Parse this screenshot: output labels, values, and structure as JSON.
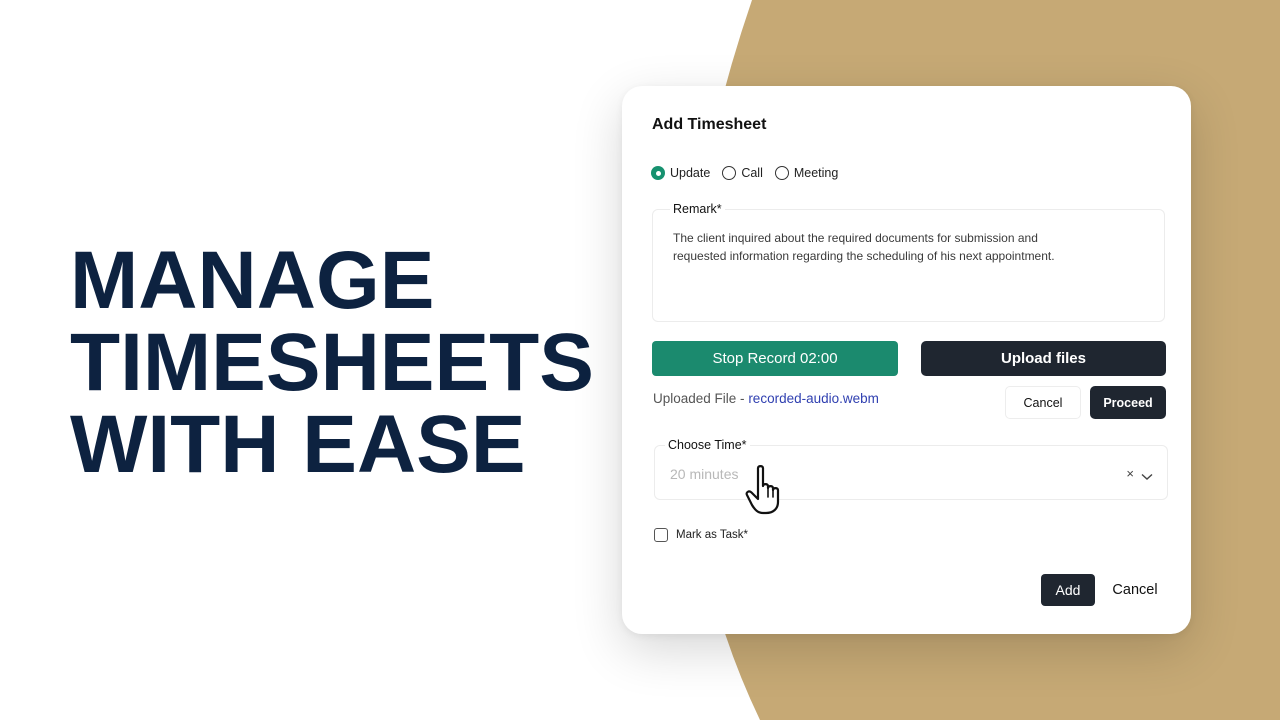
{
  "headline": {
    "line1": "MANAGE",
    "line2": "TIMESHEETS",
    "line3": "WITH EASE"
  },
  "colors": {
    "accent_tan": "#c6a975",
    "headline_navy": "#0d2240",
    "record_green": "#1b8a6e",
    "dark_button": "#1f2630",
    "link_blue": "#2f3fb0"
  },
  "dialog": {
    "title": "Add Timesheet",
    "type_options": [
      {
        "label": "Update",
        "checked": true
      },
      {
        "label": "Call",
        "checked": false
      },
      {
        "label": "Meeting",
        "checked": false
      }
    ],
    "remark": {
      "label": "Remark*",
      "value": "The client inquired about the required documents for submission and requested information regarding the scheduling of his next appointment."
    },
    "stop_record_label": "Stop Record 02:00",
    "upload_files_label": "Upload files",
    "uploaded_file": {
      "prefix": "Uploaded File - ",
      "name": "recorded-audio.webm"
    },
    "cancel_label": "Cancel",
    "proceed_label": "Proceed",
    "choose_time": {
      "label": "Choose Time*",
      "value": "20 minutes",
      "clear_icon": "clear-x-icon",
      "dropdown_icon": "chevron-down-icon"
    },
    "mark_as_task": {
      "label": "Mark as Task*",
      "checked": false
    },
    "footer": {
      "add_label": "Add",
      "cancel_label": "Cancel"
    }
  },
  "cursor_icon": "hand-pointer-icon"
}
